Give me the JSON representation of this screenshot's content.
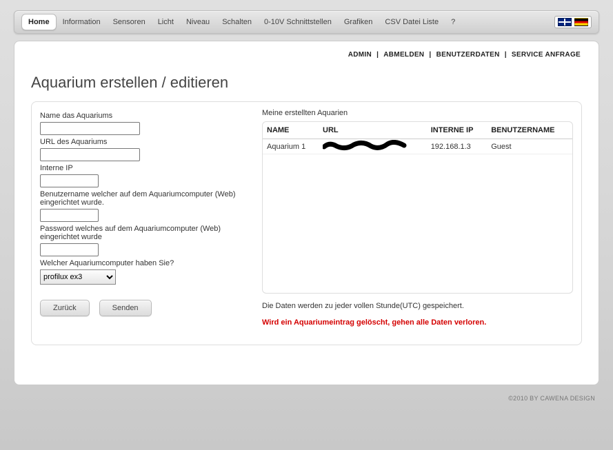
{
  "nav": {
    "items": [
      "Home",
      "Information",
      "Sensoren",
      "Licht",
      "Niveau",
      "Schalten",
      "0-10V Schnittstellen",
      "Grafiken",
      "CSV Datei Liste",
      "?"
    ],
    "active": 0
  },
  "admin_links": [
    "ADMIN",
    "ABMELDEN",
    "BENUTZERDATEN",
    "SERVICE ANFRAGE"
  ],
  "page_title": "Aquarium erstellen / editieren",
  "form": {
    "name_label": "Name das Aquariums",
    "url_label": "URL des Aquariums",
    "ip_label": "Interne IP",
    "user_label": "Benutzername welcher auf dem Aquariumcomputer (Web) eingerichtet wurde.",
    "pass_label": "Password welches auf dem Aquariumcomputer (Web) eingerichtet wurde",
    "computer_label": "Welcher Aquariumcomputer haben Sie?",
    "computer_selected": "profilux ex3",
    "back_btn": "Zurück",
    "send_btn": "Senden",
    "name_value": "",
    "url_value": "",
    "ip_value": "",
    "user_value": "",
    "pass_value": ""
  },
  "list": {
    "title": "Meine erstellten Aquarien",
    "headers": [
      "NAME",
      "URL",
      "INTERNE IP",
      "BENUTZERNAME"
    ],
    "rows": [
      {
        "name": "Aquarium 1",
        "url": "",
        "ip": "192.168.1.3",
        "user": "Guest"
      }
    ]
  },
  "messages": {
    "info": "Die Daten werden zu jeder vollen Stunde(UTC) gespeichert.",
    "warn": "Wird ein Aquariumeintrag gelöscht, gehen alle Daten verloren."
  },
  "footer": "©2010 BY CAWENA DESIGN"
}
